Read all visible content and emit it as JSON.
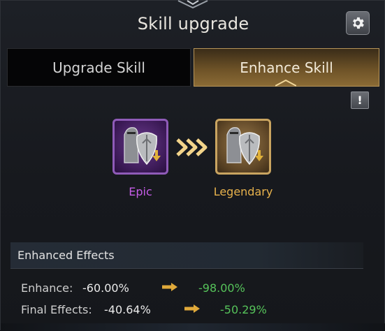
{
  "header": {
    "title": "Skill upgrade"
  },
  "tabs": [
    {
      "label": "Upgrade Skill",
      "active": false
    },
    {
      "label": "Enhance Skill",
      "active": true
    }
  ],
  "info_button": {
    "label": "!"
  },
  "skill": {
    "from_grade": "Epic",
    "to_grade": "Legendary"
  },
  "effects": {
    "title": "Enhanced Effects",
    "rows": [
      {
        "label": "Enhance:",
        "old": "-60.00%",
        "new": "-98.00%"
      },
      {
        "label": "Final Effects:",
        "old": "-40.64%",
        "new": "-50.29%"
      }
    ]
  },
  "colors": {
    "epic": "#c65de8",
    "legendary": "#e8b24c",
    "positive": "#56c35a",
    "arrow": "#e0a93a"
  }
}
